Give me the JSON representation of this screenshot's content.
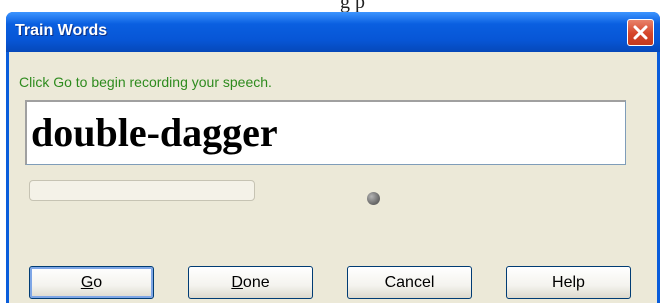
{
  "background": {
    "partial_text": "g    p"
  },
  "window": {
    "title": "Train Words",
    "close_icon": "close-x-icon"
  },
  "instruction": "Click Go to begin recording your speech.",
  "word": "double-dagger",
  "progress": {
    "fraction": 0
  },
  "indicator": {
    "state": "inactive",
    "color": "#6e6e6e"
  },
  "buttons": {
    "go": {
      "mnemonic": "G",
      "rest": "o"
    },
    "done": {
      "mnemonic": "D",
      "rest": "one"
    },
    "cancel": "Cancel",
    "help": "Help"
  },
  "colors": {
    "titlebar": "#0a5ddb",
    "dialog_face": "#ece9d8",
    "instruction_text": "#2e8b1e",
    "close_button": "#d5452a"
  }
}
